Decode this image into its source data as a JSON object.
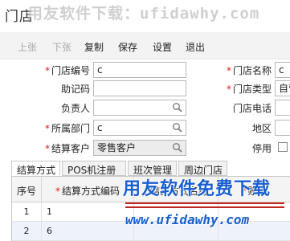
{
  "window": {
    "title": "门店"
  },
  "watermark_top": "用友软件下载：ufidawhy.com",
  "watermark_bottom": {
    "line1": "用友软件免费下载",
    "line2": "www.ufidawhy.com"
  },
  "toolbar": {
    "prev": "上张",
    "next": "下张",
    "copy": "复制",
    "save": "保存",
    "settings": "设置",
    "exit": "退出"
  },
  "form": {
    "store_code": {
      "label": "门店编号",
      "value": "c"
    },
    "mnemonic": {
      "label": "助记码",
      "value": ""
    },
    "manager": {
      "label": "负责人",
      "value": ""
    },
    "department": {
      "label": "所属部门",
      "value": "c"
    },
    "settle_customer": {
      "label": "结算客户",
      "value": "零售客户"
    },
    "store_name": {
      "label": "门店名称",
      "value": "c"
    },
    "store_type": {
      "label": "门店类型",
      "value": "自营"
    },
    "store_phone": {
      "label": "门店电话",
      "value": ""
    },
    "region": {
      "label": "地区",
      "value": ""
    },
    "disabled": {
      "label": "停用"
    }
  },
  "tabs": [
    {
      "label": "结算方式"
    },
    {
      "label": "POS机注册"
    },
    {
      "label": "班次管理"
    },
    {
      "label": "周边门店"
    }
  ],
  "grid": {
    "columns": [
      "序号",
      "结算方式编码",
      "结算方式名称",
      "账号"
    ],
    "rows": [
      {
        "no": "1",
        "code": "1",
        "name": "",
        "account": ""
      },
      {
        "no": "2",
        "code": "6",
        "name": "",
        "account": ""
      }
    ]
  }
}
